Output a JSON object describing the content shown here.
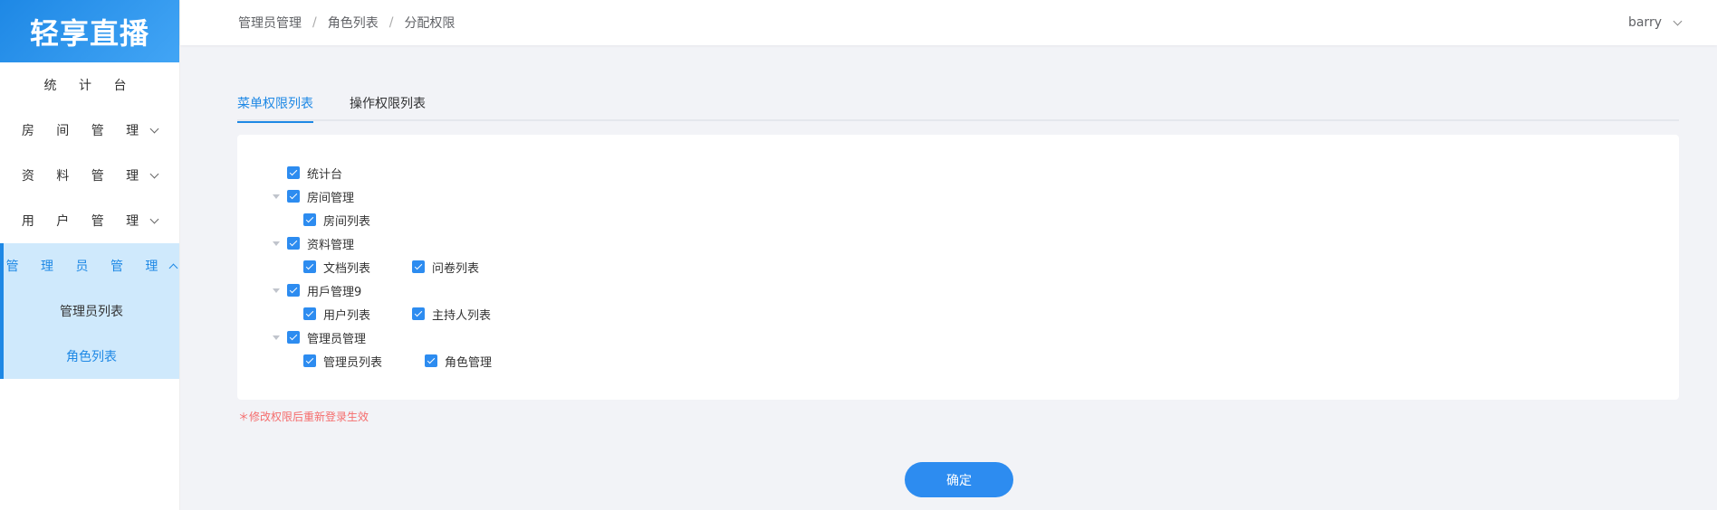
{
  "app": {
    "logo_text": "轻享直播"
  },
  "sidebar": {
    "items": [
      {
        "label": "统 计 台"
      },
      {
        "label": "房 间 管 理"
      },
      {
        "label": "资 料 管 理"
      },
      {
        "label": "用 户 管 理"
      },
      {
        "label": "管 理 员 管 理"
      }
    ],
    "subitems": [
      {
        "label": "管理员列表"
      },
      {
        "label": "角色列表"
      }
    ]
  },
  "header": {
    "breadcrumb": [
      "管理员管理",
      "角色列表",
      "分配权限"
    ],
    "separator": "/",
    "user": "barry"
  },
  "tabs": [
    {
      "label": "菜单权限列表"
    },
    {
      "label": "操作权限列表"
    }
  ],
  "tree": {
    "dashboard": "统计台",
    "room_mgmt": "房间管理",
    "room_list": "房间列表",
    "material_mgmt": "资料管理",
    "doc_list": "文档列表",
    "survey_list": "问卷列表",
    "user_mgmt": "用戶管理9",
    "user_list": "用户列表",
    "host_list": "主持人列表",
    "admin_mgmt": "管理员管理",
    "admin_list": "管理员列表",
    "role_mgmt": "角色管理"
  },
  "note": "＊修改权限后重新登录生效",
  "confirm_label": "确定",
  "colors": {
    "accent": "#2d8cf0",
    "warning": "#f56c6c"
  }
}
